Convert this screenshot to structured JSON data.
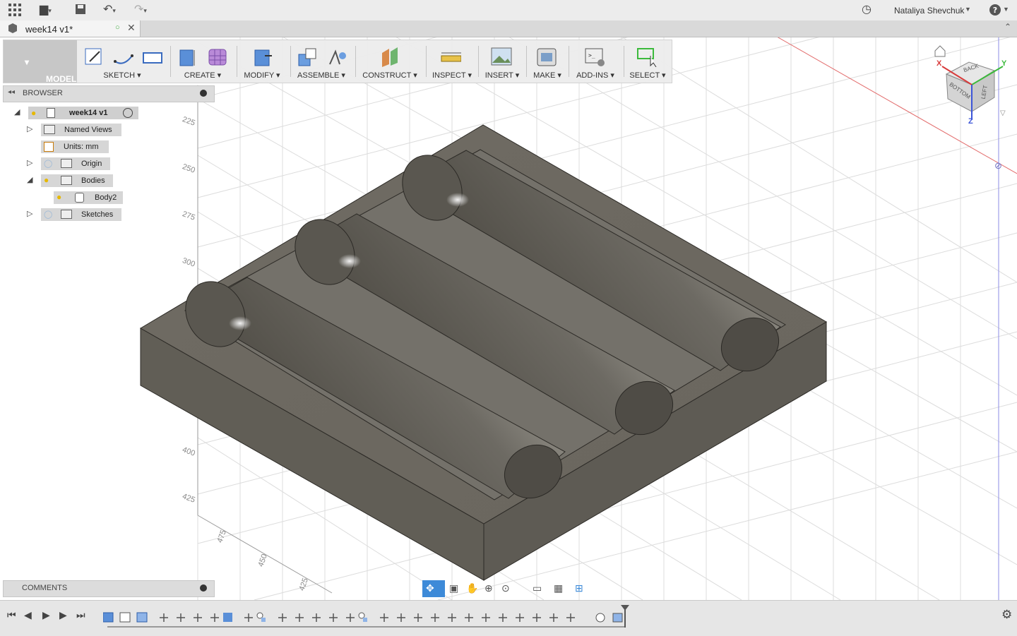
{
  "topbar": {
    "user_name": "Nataliya Shevchuk",
    "icons": [
      "apps-grid-icon",
      "file-icon",
      "save-icon",
      "undo-icon",
      "redo-icon",
      "history-clock-icon",
      "help-icon"
    ]
  },
  "tab": {
    "title": "week14 v1*"
  },
  "toolbar": {
    "workspace": "MODEL",
    "groups": [
      {
        "label": "SKETCH"
      },
      {
        "label": "CREATE"
      },
      {
        "label": "MODIFY"
      },
      {
        "label": "ASSEMBLE"
      },
      {
        "label": "CONSTRUCT"
      },
      {
        "label": "INSPECT"
      },
      {
        "label": "INSERT"
      },
      {
        "label": "MAKE"
      },
      {
        "label": "ADD-INS"
      },
      {
        "label": "SELECT"
      }
    ]
  },
  "browser": {
    "title": "BROWSER",
    "root": "week14 v1",
    "items": [
      {
        "label": "Named Views"
      },
      {
        "label": "Units: mm"
      },
      {
        "label": "Origin"
      },
      {
        "label": "Bodies"
      },
      {
        "label": "Body2"
      },
      {
        "label": "Sketches"
      }
    ]
  },
  "viewcube": {
    "faces": [
      "BACK",
      "BOTTOM",
      "LEFT"
    ],
    "axes": [
      "X",
      "Y",
      "Z"
    ]
  },
  "ruler": {
    "left": [
      "225",
      "250",
      "275",
      "300",
      "400",
      "425"
    ],
    "bottom": [
      "475",
      "450",
      "425"
    ]
  },
  "comments": {
    "title": "COMMENTS"
  },
  "colors": {
    "accent": "#3d8ad8",
    "model": "#6e6a60",
    "viewport_bg": "#ffffff"
  }
}
